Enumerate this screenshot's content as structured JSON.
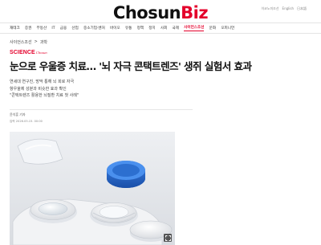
{
  "header": {
    "top_links": [
      "이코노미조선",
      "English",
      "日本語"
    ],
    "logo_main": "Chosun",
    "logo_biz": "Biz"
  },
  "nav": {
    "items": [
      "재테크",
      "증권",
      "부동산",
      "IT",
      "금융",
      "산업",
      "중소기업·벤처",
      "바이오",
      "유통",
      "정책",
      "정치",
      "사회",
      "국제",
      "사이언스조선",
      "문화",
      "오피니언"
    ],
    "active": "사이언스조선"
  },
  "breadcrumb": {
    "section": "사이언스조선",
    "separator": ">",
    "category": "과학"
  },
  "section_logo": {
    "main": "SCIENCE",
    "sub": "Chosun"
  },
  "article": {
    "headline": "눈으로 우울증 치료… '뇌 자극 콘택트렌즈' 생쥐 실험서 효과",
    "subheads": [
      "연세대 연구진, 망막 통해 뇌 회로 자극",
      "항우울제 성분과 비슷한 효과 확인",
      "\"콘택트렌즈 활용한 뇌질환 치료 첫 사례\""
    ],
    "byline": "윤석훈 기자",
    "date": "입력 2026.05.15. 00:00"
  },
  "colors": {
    "accent": "#e4002b",
    "text": "#111111",
    "photo_bg": "#e6e8ec",
    "cap_blue": "#1f5fbf"
  },
  "icons": {
    "zoom": "zoom-expand-icon"
  }
}
